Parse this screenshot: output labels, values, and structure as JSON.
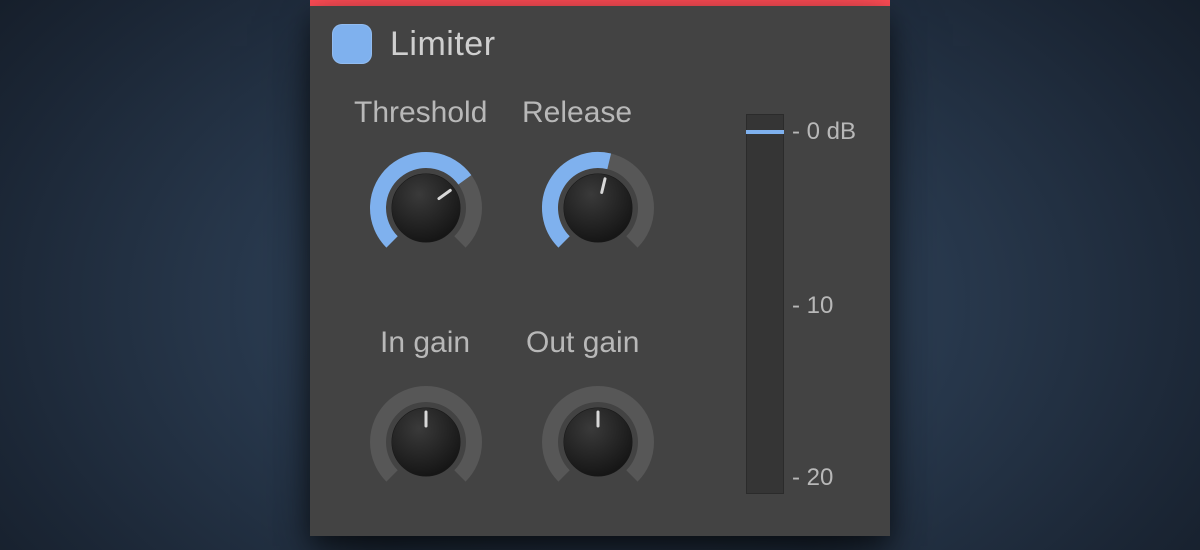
{
  "plugin": {
    "title": "Limiter",
    "accent_color": "#ff4d56",
    "enable_color": "#7fb1ee",
    "enabled": true
  },
  "knobs": {
    "threshold": {
      "label": "Threshold",
      "value_pct": 70,
      "bipolar": false
    },
    "release": {
      "label": "Release",
      "value_pct": 55,
      "bipolar": false
    },
    "in_gain": {
      "label": "In gain",
      "value_pct": 50,
      "bipolar": true
    },
    "out_gain": {
      "label": "Out gain",
      "value_pct": 50,
      "bipolar": true
    }
  },
  "meter": {
    "labels": {
      "l0": "- 0 dB",
      "l10": "- 10",
      "l20": "- 20"
    },
    "marker_db": 0,
    "range_db": [
      0,
      -20
    ]
  }
}
